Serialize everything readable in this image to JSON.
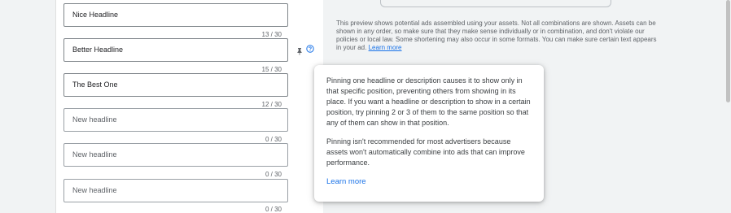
{
  "headlines": [
    {
      "value": "Nice Headline",
      "counter": "13 / 30"
    },
    {
      "value": "Better Headline",
      "counter": "15 / 30"
    },
    {
      "value": "The Best One",
      "counter": "12 / 30"
    },
    {
      "placeholder": "New headline",
      "counter": "0 / 30"
    },
    {
      "placeholder": "New headline",
      "counter": "0 / 30"
    },
    {
      "placeholder": "New headline",
      "counter": "0 / 30"
    }
  ],
  "preview": {
    "note": "This preview shows potential ads assembled using your assets. Not all combinations are shown. Assets can be shown in any order, so make sure that they make sense individually or in combination, and don't violate our policies or local law. Some shortening may also occur in some formats. You can make sure certain text appears in your ad.",
    "learn_more": "Learn more"
  },
  "tooltip": {
    "paragraph1": "Pinning one headline or description causes it to show only in that specific position, preventing others from showing in its place. If you want a headline or description to show in a certain position, try pinning 2 or 3 of them to the same position so that any of them can show in that position.",
    "paragraph2": "Pinning isn't recommended for most advertisers because assets won't automatically combine into ads that can improve performance.",
    "learn_more": "Learn more"
  },
  "icons": {
    "pin": "pin-icon",
    "help": "help-icon"
  },
  "colors": {
    "link": "#1a73e8",
    "text": "#202124",
    "muted": "#5f6368",
    "border": "#80868b"
  }
}
